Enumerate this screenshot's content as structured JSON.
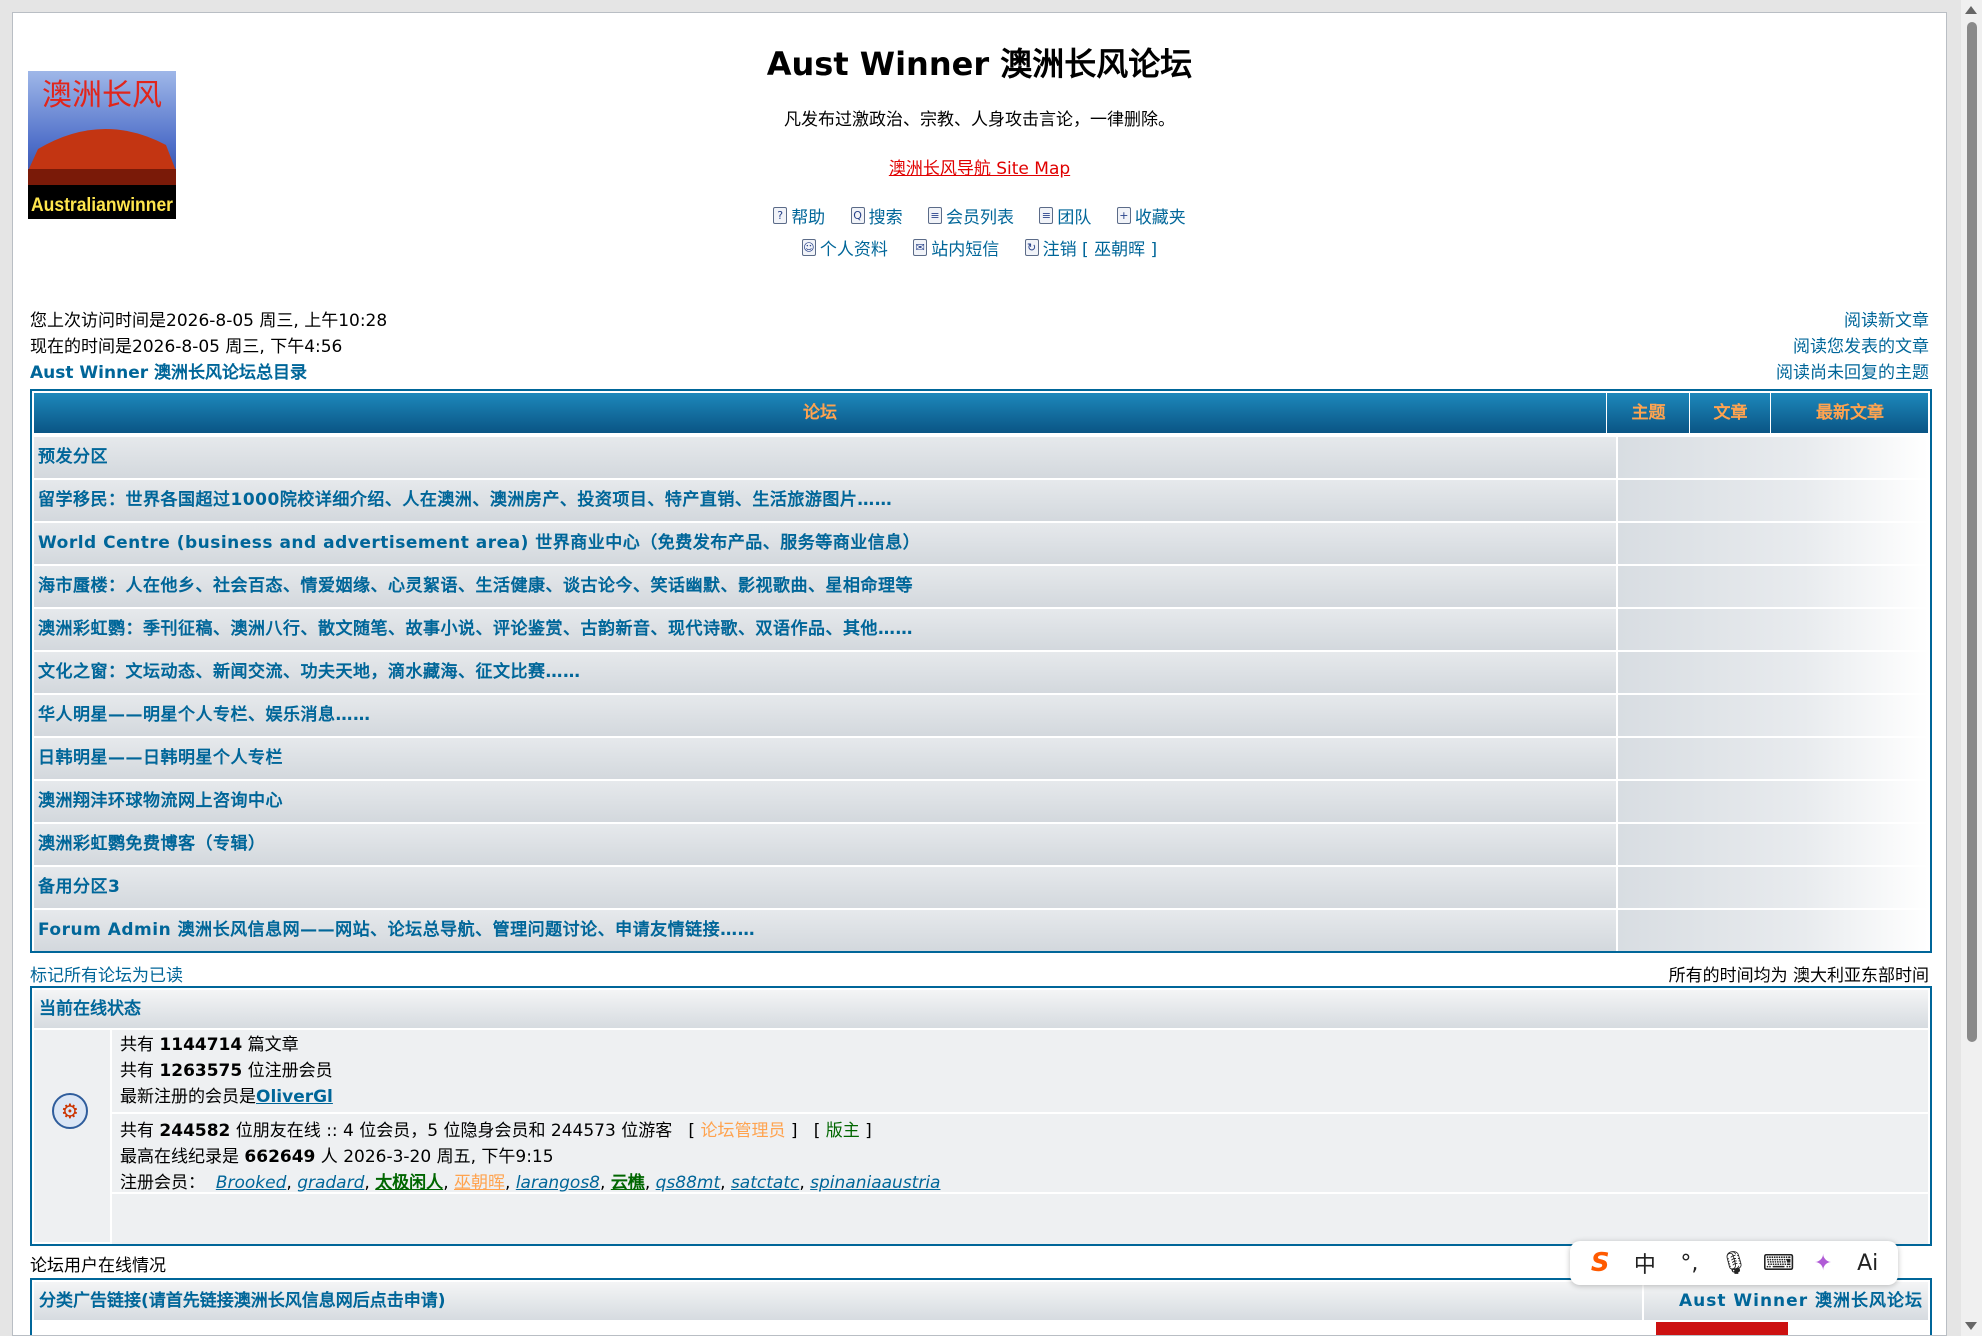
{
  "header": {
    "title": "Aust Winner 澳洲长风论坛",
    "description": "凡发布过激政治、宗教、人身攻击言论，一律删除。",
    "sitemap_link": "澳洲长风导航 Site Map",
    "logo_text_top": "澳洲长风",
    "logo_text_bottom": "Australianwinner",
    "nav_row1": [
      {
        "label": "帮助",
        "icon": "help-icon"
      },
      {
        "label": "搜索",
        "icon": "search-icon"
      },
      {
        "label": "会员列表",
        "icon": "memberlist-icon"
      },
      {
        "label": "团队",
        "icon": "group-icon"
      },
      {
        "label": "收藏夹",
        "icon": "favorites-icon"
      }
    ],
    "nav_row2": [
      {
        "label": "个人资料",
        "icon": "profile-icon"
      },
      {
        "label": "站内短信",
        "icon": "messages-icon"
      },
      {
        "label": "注销 [ 巫朝晖 ]",
        "icon": "logout-icon"
      }
    ]
  },
  "info": {
    "last_visit": "您上次访问时间是2026-8-05 周三, 上午10:28",
    "current_time": "现在的时间是2026-8-05 周三, 下午4:56",
    "index_link": "Aust Winner 澳洲长风论坛总目录",
    "right_links": [
      "阅读新文章",
      "阅读您发表的文章",
      "阅读尚未回复的主题"
    ]
  },
  "forum_table": {
    "headers": {
      "forum": "论坛",
      "topics": "主题",
      "posts": "文章",
      "last_post": "最新文章"
    },
    "categories": [
      "预发分区",
      "留学移民：世界各国超过1000院校详细介绍、人在澳洲、澳洲房产、投资项目、特产直销、生活旅游图片……",
      "World Centre (business and advertisement area) 世界商业中心（免费发布产品、服务等商业信息）",
      "海市蜃楼：人在他乡、社会百态、情爱姻缘、心灵絮语、生活健康、谈古论今、笑话幽默、影视歌曲、星相命理等",
      "澳洲彩虹鹦：季刊征稿、澳洲八行、散文随笔、故事小说、评论鉴赏、古韵新音、现代诗歌、双语作品、其他……",
      "文化之窗：文坛动态、新闻交流、功夫天地，滴水藏海、征文比赛……",
      "华人明星——明星个人专栏、娱乐消息……",
      "日韩明星——日韩明星个人专栏",
      "澳洲翔沣环球物流网上咨询中心",
      "澳洲彩虹鹦免费博客（专辑）",
      "备用分区3",
      "Forum Admin 澳洲长风信息网——网站、论坛总导航、管理问题讨论、申请友情链接……"
    ]
  },
  "mark_all_read": "标记所有论坛为已读",
  "timezone_note": "所有的时间均为 澳大利亚东部时间",
  "online": {
    "header": "当前在线状态",
    "total_posts_prefix": "共有 ",
    "total_posts": "1144714",
    "total_posts_suffix": " 篇文章",
    "total_users_prefix": "共有 ",
    "total_users": "1263575",
    "total_users_suffix": " 位注册会员",
    "newest_prefix": "最新注册的会员是",
    "newest_user": "OliverGl",
    "online_prefix": "共有 ",
    "online_count": "244582",
    "online_suffix": " 位朋友在线 :: 4 位会员，5 位隐身会员和 244573 位游客",
    "admin_label": "论坛管理员",
    "mod_label": "版主",
    "record_prefix": "最高在线纪录是 ",
    "record_count": "662649",
    "record_suffix": " 人 2026-3-20 周五, 下午9:15",
    "registered_label": "注册会员：",
    "users": [
      {
        "name": "Brooked",
        "style": "normal"
      },
      {
        "name": "gradard",
        "style": "normal"
      },
      {
        "name": "太极闲人",
        "style": "bold-green"
      },
      {
        "name": "巫朝晖",
        "style": "orange"
      },
      {
        "name": "larangos8",
        "style": "normal"
      },
      {
        "name": "云樵",
        "style": "bold-green"
      },
      {
        "name": "qs88mt",
        "style": "normal"
      },
      {
        "name": "satctatc",
        "style": "normal"
      },
      {
        "name": "spinaniaaustria",
        "style": "normal"
      }
    ]
  },
  "user_status_label": "论坛用户在线情况",
  "ads": {
    "left_header": "分类广告链接(请首先链接澳洲长风信息网后点击申请)",
    "right_header": "Aust Winner 澳洲长风论坛"
  },
  "ime": [
    "S",
    "中",
    "°,",
    "mic-icon",
    "keyboard-icon",
    "skin-icon",
    "Ai"
  ],
  "colors": {
    "link": "#006699",
    "header_orange": "#ffa34f",
    "border": "#006699"
  }
}
